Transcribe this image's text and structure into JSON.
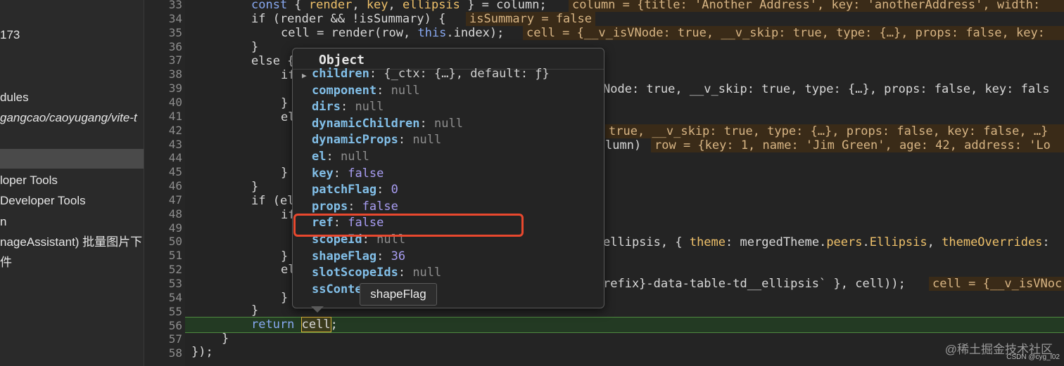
{
  "sidebar": {
    "items": [
      "173",
      "dules",
      "gangcao/caoyugang/vite-t",
      "loper Tools",
      "Developer Tools",
      "n",
      "nageAssistant) 批量图片下",
      "件"
    ]
  },
  "code": {
    "line_numbers": [
      "33",
      "34",
      "35",
      "36",
      "37",
      "38",
      "39",
      "40",
      "41",
      "42",
      "43",
      "44",
      "45",
      "46",
      "47",
      "48",
      "49",
      "50",
      "51",
      "52",
      "53",
      "54",
      "55",
      "56",
      "57",
      "58"
    ],
    "l33": "const { render, key, ellipsis } = column;",
    "l34_a": "if (render && !isSummary) {",
    "l35_a": "cell = render(row, ",
    "l35_b": "this",
    "l35_c": ".index);",
    "l36": "}",
    "l37": "else {",
    "l38": "if",
    "l40": "}",
    "l41": "el",
    "l45": "}",
    "l46": "}",
    "l47": "if (el",
    "l48": "if",
    "l50_a": "ellipsis, { ",
    "l50_b": "theme",
    "l50_c": ": mergedTheme.",
    "l50_d": "peers",
    "l50_e": ".",
    "l50_f": "Ellipsis",
    "l50_g": ", ",
    "l50_h": "themeOverrides",
    "l50_i": ":",
    "l51": "}",
    "l52": "el",
    "l53_a": "refix}-data-table-td__ellipsis` }, cell));",
    "l54": "}",
    "l55": "}",
    "l56_a": "return ",
    "l56_b": "cell",
    "l56_c": ";",
    "l57": "}",
    "l58": "});",
    "inline_l33": "column = {title: 'Another Address', key: 'anotherAddress', width:",
    "inline_l34": "isSummary = false",
    "inline_l35": "cell = {__v_isVNode: true, __v_skip: true, type: {…}, props: false, key:",
    "inline_l39": "Node: true, __v_skip: true, type: {…}, props: false, key: fals",
    "inline_l42": "true, __v_skip: true, type: {…}, props: false, key: false, …}",
    "l43": "lumn)",
    "inline_l43": "row = {key: 1, name: 'Jim Green', age: 42, address: 'Lo",
    "inline_l53": "cell = {__v_isVNoc"
  },
  "popup": {
    "title": "Object",
    "props": [
      {
        "key": "children",
        "value": "{_ctx: {…}, default: ƒ}",
        "kind": "obj"
      },
      {
        "key": "component",
        "value": "null",
        "kind": "null"
      },
      {
        "key": "dirs",
        "value": "null",
        "kind": "null"
      },
      {
        "key": "dynamicChildren",
        "value": "null",
        "kind": "null"
      },
      {
        "key": "dynamicProps",
        "value": "null",
        "kind": "null"
      },
      {
        "key": "el",
        "value": "null",
        "kind": "null"
      },
      {
        "key": "key",
        "value": "false",
        "kind": "val"
      },
      {
        "key": "patchFlag",
        "value": "0",
        "kind": "val"
      },
      {
        "key": "props",
        "value": "false",
        "kind": "val"
      },
      {
        "key": "ref",
        "value": "false",
        "kind": "val"
      },
      {
        "key": "scopeId",
        "value": "null",
        "kind": "null"
      },
      {
        "key": "shapeFlag",
        "value": "36",
        "kind": "val"
      },
      {
        "key": "slotScopeIds",
        "value": "null",
        "kind": "null"
      },
      {
        "key": "ssConte",
        "value": "",
        "kind": "null"
      }
    ],
    "tooltip": "shapeFlag"
  },
  "watermark": "@稀土掘金技术社区",
  "watermark_small": "CSDN @cyg_l02",
  "colors": {
    "highlight_border": "#e8482e",
    "current_line": "#233a23",
    "property_key": "#82bfe8",
    "property_value": "#a89df2"
  }
}
